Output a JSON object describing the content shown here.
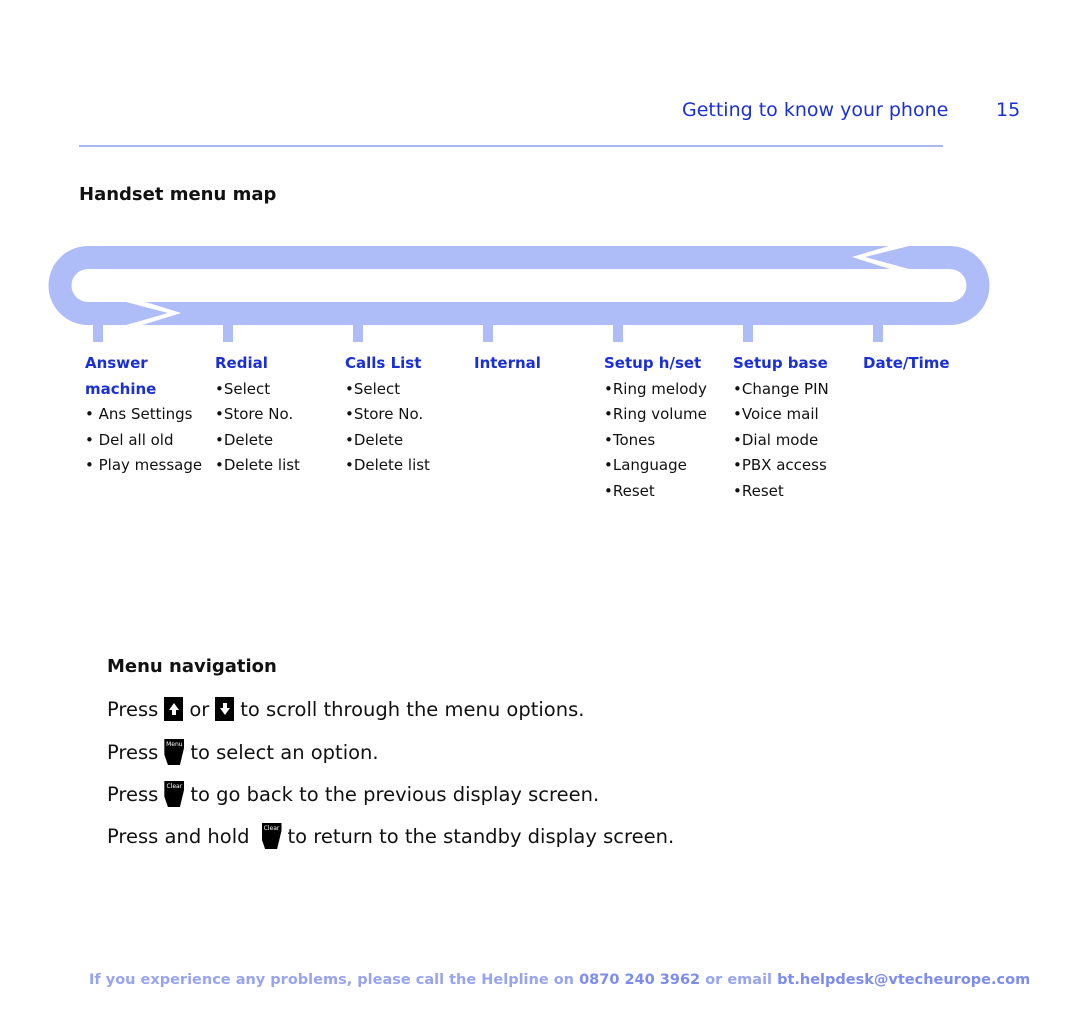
{
  "header": {
    "section_title": "Getting to know your phone",
    "page_number": "15"
  },
  "menu_map": {
    "title": "Handset menu map",
    "columns": [
      {
        "heading": [
          "Answer",
          "machine"
        ],
        "items": [
          "• Ans Settings",
          "• Del all old",
          "• Play message"
        ]
      },
      {
        "heading": [
          "Redial"
        ],
        "items": [
          "•Select",
          "•Store No.",
          "•Delete",
          "•Delete list"
        ]
      },
      {
        "heading": [
          "Calls List"
        ],
        "items": [
          "•Select",
          "•Store No.",
          "•Delete",
          "•Delete list"
        ]
      },
      {
        "heading": [
          "Internal"
        ],
        "items": []
      },
      {
        "heading": [
          "Setup h/set"
        ],
        "items": [
          "•Ring melody",
          "•Ring volume",
          "•Tones",
          "•Language",
          "•Reset"
        ]
      },
      {
        "heading": [
          "Setup base"
        ],
        "items": [
          "•Change PIN",
          "•Voice mail",
          "•Dial mode",
          "•PBX access",
          "•Reset"
        ]
      },
      {
        "heading": [
          "Date/Time"
        ],
        "items": []
      }
    ],
    "loop_color": "#aebdf7"
  },
  "navigation": {
    "title": "Menu navigation",
    "lines": [
      {
        "before": "Press",
        "keys": [
          "up-key",
          "down-key"
        ],
        "joiner": "or",
        "after": "to scroll through the menu options."
      },
      {
        "before": "Press",
        "keys": [
          "menu-key"
        ],
        "after": "to select an option."
      },
      {
        "before": "Press",
        "keys": [
          "clear-key"
        ],
        "after": "to go back to the previous display screen."
      },
      {
        "before": "Press and hold",
        "keys": [
          "clear-key"
        ],
        "after": "to return to the standby display screen."
      }
    ],
    "key_labels": {
      "menu": "Menu",
      "clear": "Clear",
      "up": "▲",
      "down": "▼"
    }
  },
  "footer": {
    "text1": "If you experience any problems, please call the Helpline on ",
    "phone": "0870 240 3962",
    "text2": " or email ",
    "email": "bt.helpdesk@vtecheurope.com"
  }
}
